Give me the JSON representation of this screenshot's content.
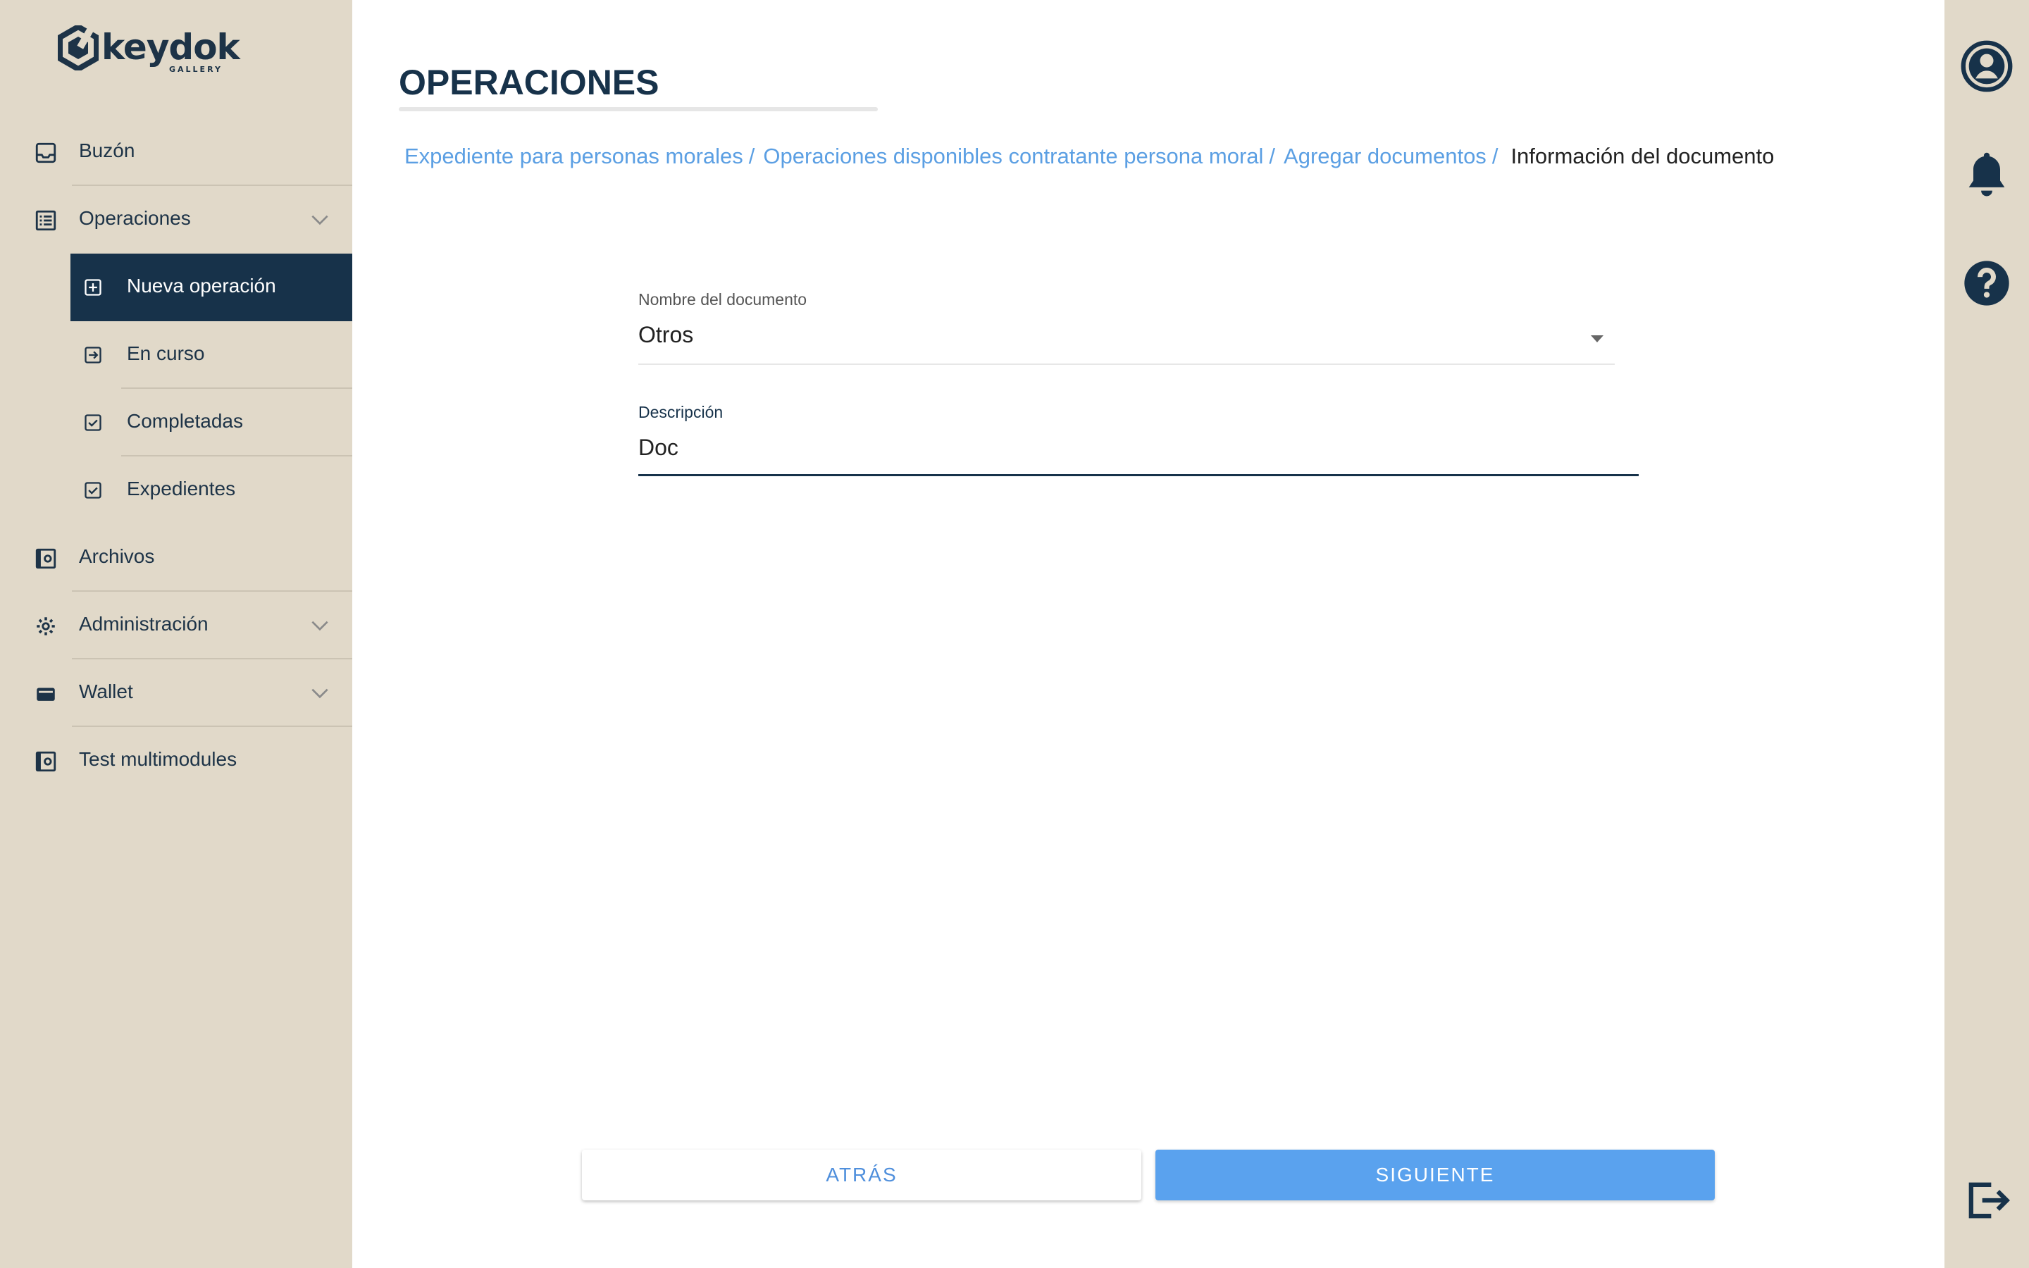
{
  "logo": {
    "word": "keydok",
    "sub": "GALLERY"
  },
  "nav": {
    "items": [
      {
        "label": "Buzón",
        "icon": "inbox-icon"
      },
      {
        "label": "Operaciones",
        "icon": "list-icon",
        "expandable": true
      },
      {
        "label": "Nueva operación",
        "icon": "add-box-icon",
        "active": true
      },
      {
        "label": "En curso",
        "icon": "arrow-box-icon"
      },
      {
        "label": "Completadas",
        "icon": "check-box-icon"
      },
      {
        "label": "Expedientes",
        "icon": "check-box-icon"
      },
      {
        "label": "Archivos",
        "icon": "file-box-icon"
      },
      {
        "label": "Administración",
        "icon": "gear-icon",
        "expandable": true
      },
      {
        "label": "Wallet",
        "icon": "wallet-icon",
        "expandable": true
      },
      {
        "label": "Test multimodules",
        "icon": "file-box-icon"
      }
    ]
  },
  "page": {
    "title": "OPERACIONES"
  },
  "breadcrumb": {
    "links": [
      "Expediente para personas morales",
      "Operaciones disponibles contratante persona moral",
      "Agregar documentos"
    ],
    "separator": "/",
    "current": "Información del documento"
  },
  "form": {
    "document_name": {
      "label": "Nombre del documento",
      "value": "Otros"
    },
    "description": {
      "label": "Descripción",
      "value": "Doc"
    }
  },
  "buttons": {
    "back": "ATRÁS",
    "next": "SIGUIENTE"
  },
  "rail": {
    "icons": [
      "account-circle-icon",
      "bell-icon",
      "help-icon",
      "logout-icon"
    ]
  },
  "colors": {
    "sidebar_bg": "#e1d9c9",
    "active_bg": "#17324a",
    "link": "#5b9fe3",
    "primary_button": "#5aa2ee"
  }
}
